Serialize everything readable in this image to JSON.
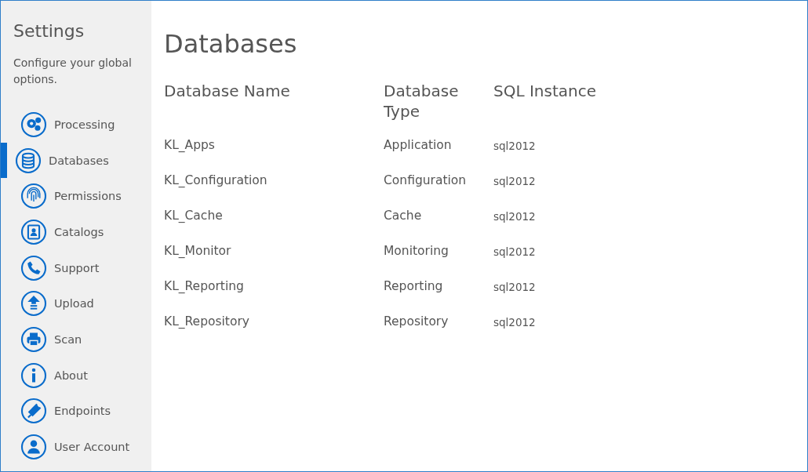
{
  "sidebar": {
    "title": "Settings",
    "description": "Configure your global options.",
    "items": [
      {
        "label": "Processing",
        "selected": false
      },
      {
        "label": "Databases",
        "selected": true
      },
      {
        "label": "Permissions",
        "selected": false
      },
      {
        "label": "Catalogs",
        "selected": false
      },
      {
        "label": "Support",
        "selected": false
      },
      {
        "label": "Upload",
        "selected": false
      },
      {
        "label": "Scan",
        "selected": false
      },
      {
        "label": "About",
        "selected": false
      },
      {
        "label": "Endpoints",
        "selected": false
      },
      {
        "label": "User Account",
        "selected": false
      }
    ]
  },
  "page": {
    "title": "Databases",
    "table": {
      "columns": [
        "Database Name",
        "Database Type",
        "SQL Instance"
      ],
      "rows": [
        [
          "KL_Apps",
          "Application",
          "sql2012"
        ],
        [
          "KL_Configuration",
          "Configuration",
          "sql2012"
        ],
        [
          "KL_Cache",
          "Cache",
          "sql2012"
        ],
        [
          "KL_Monitor",
          "Monitoring",
          "sql2012"
        ],
        [
          "KL_Reporting",
          "Reporting",
          "sql2012"
        ],
        [
          "KL_Repository",
          "Repository",
          "sql2012"
        ]
      ]
    }
  }
}
